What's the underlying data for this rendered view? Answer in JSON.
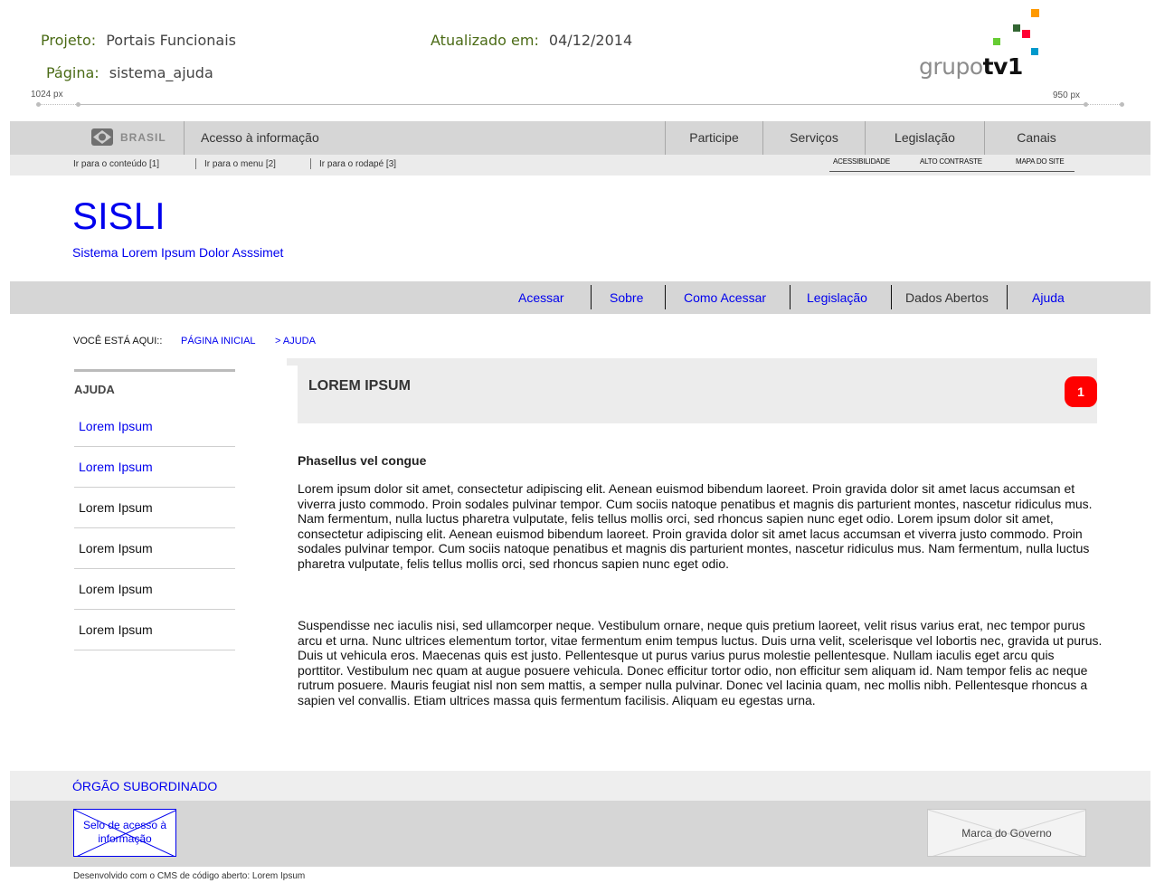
{
  "annotations": {
    "project_label": "Projeto:",
    "project_value": "Portais Funcionais",
    "page_label": "Página:",
    "page_value": "sistema_ajuda",
    "updated_label": "Atualizado em:",
    "updated_value": "04/12/2014",
    "ruler_left": "1024 px",
    "ruler_right": "950 px"
  },
  "logo": {
    "text_light": "grupo",
    "text_bold": "tv1",
    "colors": [
      "#ff9900",
      "#ff0033",
      "#66cc33",
      "#0099cc",
      "#336633",
      "#cc3300"
    ]
  },
  "gov_bar": {
    "brasil": "BRASIL",
    "access": "Acesso à informação",
    "items": [
      "Participe",
      "Serviços",
      "Legislação",
      "Canais"
    ]
  },
  "skip_links": [
    "Ir para o conteúdo [1]",
    "Ir para o menu [2]",
    "Ir para o rodapé [3]"
  ],
  "accessibility_links": [
    "ACESSIBILIDADE",
    "ALTO CONTRASTE",
    "MAPA DO SITE"
  ],
  "site": {
    "title": "SISLI",
    "subtitle": "Sistema Lorem Ipsum Dolor Asssimet"
  },
  "nav": [
    "Acessar",
    "Sobre",
    "Como Acessar",
    "Legislação",
    "Dados Abertos",
    "Ajuda"
  ],
  "breadcrumb": {
    "label": "VOCÊ ESTÁ AQUI::",
    "home": "PÁGINA INICIAL",
    "current": "> AJUDA"
  },
  "sidebar": {
    "heading": "AJUDA",
    "items": [
      "Lorem Ipsum",
      "Lorem Ipsum",
      "Lorem Ipsum",
      "Lorem Ipsum",
      "Lorem Ipsum",
      "Lorem Ipsum"
    ]
  },
  "content": {
    "heading": "LOREM IPSUM",
    "badge": "1",
    "section_title": "Phasellus vel congue",
    "paragraph1": "Lorem ipsum dolor sit amet, consectetur adipiscing elit. Aenean euismod bibendum laoreet. Proin gravida dolor sit amet lacus accumsan et viverra justo commodo. Proin sodales pulvinar tempor. Cum sociis natoque penatibus et magnis dis parturient montes, nascetur ridiculus mus. Nam fermentum, nulla luctus pharetra vulputate, felis tellus mollis orci, sed rhoncus sapien nunc eget odio. Lorem ipsum dolor sit amet, consectetur adipiscing elit. Aenean euismod bibendum laoreet. Proin gravida dolor sit amet lacus accumsan et viverra justo commodo. Proin sodales pulvinar tempor. Cum sociis natoque penatibus et magnis dis parturient montes, nascetur ridiculus mus. Nam fermentum, nulla luctus pharetra vulputate, felis tellus mollis orci, sed rhoncus sapien nunc eget odio.",
    "paragraph2": "Suspendisse nec iaculis nisi, sed ullamcorper neque. Vestibulum ornare, neque quis pretium laoreet, velit risus varius erat, nec tempor purus arcu et urna. Nunc ultrices elementum tortor, vitae fermentum enim tempus luctus. Duis urna velit, scelerisque vel lobortis nec, gravida ut purus. Duis ut vehicula eros. Maecenas quis est justo. Pellentesque ut purus varius purus molestie pellentesque. Nullam iaculis eget arcu quis porttitor. Vestibulum nec quam at augue posuere vehicula. Donec efficitur tortor odio, non efficitur sem aliquam id. Nam tempor felis ac neque rutrum posuere. Mauris feugiat nisl non sem mattis, a semper nulla pulvinar. Donec vel lacinia quam, nec mollis nibh. Pellentesque rhoncus a sapien vel convallis. Etiam ultrices massa quis fermentum facilisis. Aliquam eu egestas urna."
  },
  "footer": {
    "title": "ÓRGÃO SUBORDINADO",
    "seal": "Selo de acesso à informação",
    "gov_mark": "Marca do Governo",
    "developed_by": "Desenvolvido com o CMS de código aberto: Lorem Ipsum"
  },
  "colors": {
    "link": "#0000ee",
    "badge": "#ff0000",
    "bar": "#d6d6d6"
  }
}
